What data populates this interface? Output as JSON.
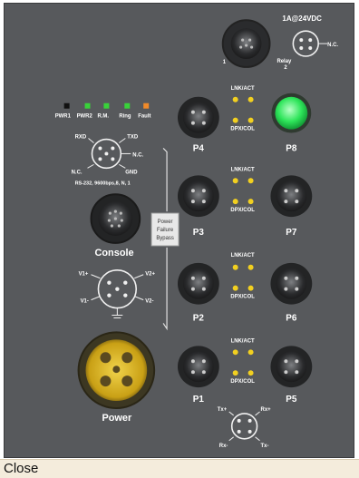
{
  "relay": {
    "rating": "1A@24VDC",
    "nc": "N.C.",
    "label": "Relay",
    "pin1": "1",
    "pin2": "2"
  },
  "leds": {
    "items": [
      {
        "label": "PWR1",
        "color": "#111111"
      },
      {
        "label": "PWR2",
        "color": "#39d23a"
      },
      {
        "label": "R.M.",
        "color": "#39d23a"
      },
      {
        "label": "Ring",
        "color": "#39d23a"
      },
      {
        "label": "Fault",
        "color": "#f08a2a"
      }
    ]
  },
  "rs232": {
    "rxd": "RXD",
    "txd": "TXD",
    "nc_left": "N.C.",
    "nc_right": "N.C.",
    "gnd": "GND",
    "spec": "RS-232, 9600bps,8, N, 1"
  },
  "console": {
    "label": "Console"
  },
  "power_failure": {
    "line1": "Power",
    "line2": "Failure",
    "line3": "Bypass"
  },
  "power_pins": {
    "v1p": "V1+",
    "v1m": "V1-",
    "v2p": "V2+",
    "v2m": "V2-"
  },
  "power": {
    "label": "Power"
  },
  "ports": {
    "p1": "P1",
    "p2": "P2",
    "p3": "P3",
    "p4": "P4",
    "p5": "P5",
    "p6": "P6",
    "p7": "P7",
    "p8": "P8"
  },
  "port_leds": {
    "lnk": "LNK/ACT",
    "dpx": "DPX/COL",
    "color": "#f2d020"
  },
  "p8_indicator_color": "#2ee55a",
  "eth_pins": {
    "txp": "Tx+",
    "rxp": "Rx+",
    "rxm": "Rx-",
    "txm": "Tx-"
  },
  "footer": {
    "close_label": "Close"
  }
}
